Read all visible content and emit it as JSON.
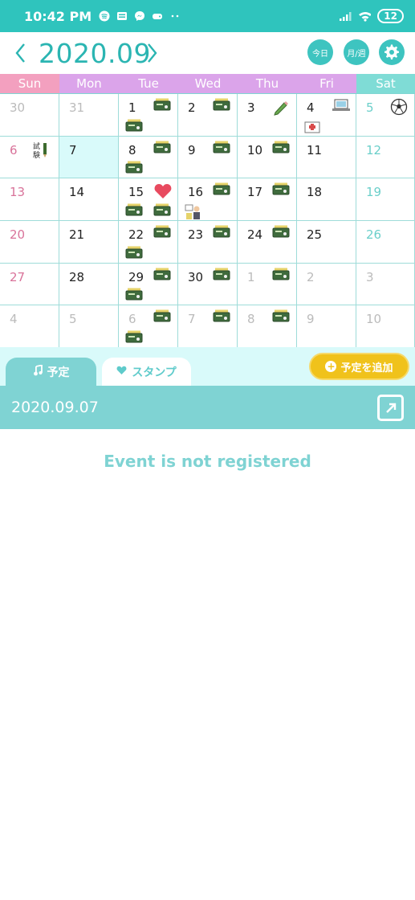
{
  "status_bar": {
    "time": "10:42 PM",
    "battery": "12"
  },
  "header": {
    "title": "2020.09",
    "today_label": "今日",
    "view_label": "月/週"
  },
  "weekdays": [
    "Sun",
    "Mon",
    "Tue",
    "Wed",
    "Thu",
    "Fri",
    "Sat"
  ],
  "weeks": [
    [
      {
        "day": "30"
      },
      {
        "day": "31"
      },
      {
        "day": "1",
        "stamps": [
          "seminar",
          "seminar"
        ]
      },
      {
        "day": "2",
        "stamps": [
          "seminar"
        ]
      },
      {
        "day": "3",
        "stamps": [
          "pencil"
        ]
      },
      {
        "day": "4",
        "stamps": [
          "laptop",
          "hospital"
        ]
      },
      {
        "day": "5",
        "stamps": [
          "soccer-ball"
        ]
      }
    ],
    [
      {
        "day": "6",
        "stamps": [
          "exam"
        ]
      },
      {
        "day": "7"
      },
      {
        "day": "8",
        "stamps": [
          "seminar",
          "seminar"
        ]
      },
      {
        "day": "9",
        "stamps": [
          "seminar"
        ]
      },
      {
        "day": "10",
        "stamps": [
          "seminar"
        ]
      },
      {
        "day": "11"
      },
      {
        "day": "12"
      }
    ],
    [
      {
        "day": "13"
      },
      {
        "day": "14"
      },
      {
        "day": "15",
        "stamps": [
          "heart",
          "seminar",
          "seminar"
        ]
      },
      {
        "day": "16",
        "stamps": [
          "seminar",
          "person"
        ]
      },
      {
        "day": "17",
        "stamps": [
          "seminar"
        ]
      },
      {
        "day": "18"
      },
      {
        "day": "19"
      }
    ],
    [
      {
        "day": "20"
      },
      {
        "day": "21"
      },
      {
        "day": "22",
        "stamps": [
          "seminar",
          "seminar"
        ]
      },
      {
        "day": "23",
        "stamps": [
          "seminar"
        ]
      },
      {
        "day": "24",
        "stamps": [
          "seminar"
        ]
      },
      {
        "day": "25"
      },
      {
        "day": "26"
      }
    ],
    [
      {
        "day": "27"
      },
      {
        "day": "28"
      },
      {
        "day": "29",
        "stamps": [
          "seminar",
          "seminar"
        ]
      },
      {
        "day": "30",
        "stamps": [
          "seminar"
        ]
      },
      {
        "day": "1",
        "stamps": [
          "seminar"
        ]
      },
      {
        "day": "2"
      },
      {
        "day": "3"
      }
    ],
    [
      {
        "day": "4"
      },
      {
        "day": "5"
      },
      {
        "day": "6",
        "stamps": [
          "seminar",
          "seminar"
        ]
      },
      {
        "day": "7",
        "stamps": [
          "seminar"
        ]
      },
      {
        "day": "8",
        "stamps": [
          "seminar"
        ]
      },
      {
        "day": "9"
      },
      {
        "day": "10"
      }
    ]
  ],
  "tabs": {
    "schedule": "予定",
    "stamp": "スタンプ"
  },
  "add_event_label": "予定を追加",
  "selected_date": "2020.09.07",
  "empty_message": "Event is not registered",
  "colors": {
    "teal": "#2fc4bd",
    "sun": "#f3a0bf",
    "weekday": "#dba4ea",
    "sat": "#7fdcd6",
    "accent_yellow": "#f0c21b"
  }
}
